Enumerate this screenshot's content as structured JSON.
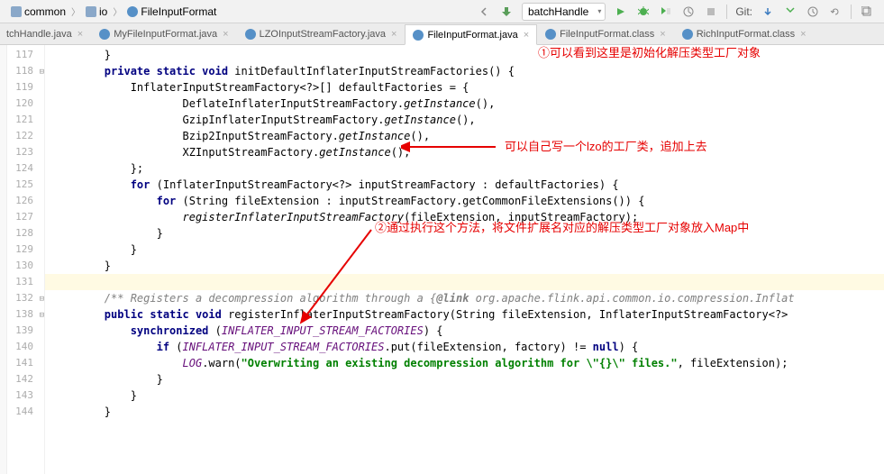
{
  "breadcrumb": {
    "items": [
      {
        "label": "common",
        "icon": "folder"
      },
      {
        "label": "io",
        "icon": "folder"
      },
      {
        "label": "FileInputFormat",
        "icon": "class"
      }
    ]
  },
  "toolbar": {
    "run_config": "batchHandle",
    "git_label": "Git:"
  },
  "tabs": [
    {
      "label": "tchHandle.java",
      "icon": "j",
      "partial": true
    },
    {
      "label": "MyFileInputFormat.java",
      "icon": "c"
    },
    {
      "label": "LZOInputStreamFactory.java",
      "icon": "c"
    },
    {
      "label": "FileInputFormat.java",
      "icon": "c",
      "active": true
    },
    {
      "label": "FileInputFormat.class",
      "icon": "c"
    },
    {
      "label": "RichInputFormat.class",
      "icon": "c"
    }
  ],
  "annotations": {
    "note1": "①可以看到这里是初始化解压类型工厂对象",
    "note2": "可以自己写一个lzo的工厂类，追加上去",
    "note3": "②通过执行这个方法，将文件扩展名对应的解压类型工厂对象放入Map中"
  },
  "line_numbers": [
    "117",
    "118",
    "119",
    "120",
    "121",
    "122",
    "123",
    "124",
    "125",
    "126",
    "127",
    "128",
    "129",
    "130",
    "131",
    "132",
    "138",
    "139",
    "140",
    "141",
    "142",
    "143",
    "144"
  ],
  "code": {
    "l117": "        }",
    "l118_private": "private static void",
    "l118_name": " initDefaultInflaterInputStreamFactories",
    "l118_rest": "() {",
    "l119": "            InflaterInputStreamFactory<?>[] defaultFactories = {",
    "l120a": "                    DeflateInflaterInputStreamFactory.",
    "l120b": "getInstance",
    "l120c": "(),",
    "l121a": "                    GzipInflaterInputStreamFactory.",
    "l121b": "getInstance",
    "l121c": "(),",
    "l122a": "                    Bzip2InputStreamFactory.",
    "l122b": "getInstance",
    "l122c": "(),",
    "l123a": "                    XZInputStreamFactory.",
    "l123b": "getInstance",
    "l123c": "(),",
    "l124": "            };",
    "l125_for": "for",
    "l125_rest": " (InflaterInputStreamFactory<?> inputStreamFactory : defaultFactories) {",
    "l126_for": "for",
    "l126_rest": " (String fileExtension : inputStreamFactory.getCommonFileExtensions()) {",
    "l127a": "                    ",
    "l127b": "registerInflaterInputStreamFactory",
    "l127c": "(fileExtension, inputStreamFactory);",
    "l128": "                }",
    "l129": "            }",
    "l130": "        }",
    "l131": "",
    "l132a": "        ",
    "l132b": "/** Registers a decompression algorithm through a {",
    "l132c": "@link",
    "l132d": " org.apache.flink.api.common.io.compression.Inflat",
    "l138_pub": "public static void",
    "l138_name": " registerInflaterInputStreamFactory",
    "l138_rest": "(String fileExtension, InflaterInputStreamFactory<?>",
    "l139_sync": "synchronized",
    "l139_rest": " (",
    "l139_field": "INFLATER_INPUT_STREAM_FACTORIES",
    "l139_end": ") {",
    "l140_if": "if",
    "l140_a": " (",
    "l140_field": "INFLATER_INPUT_STREAM_FACTORIES",
    "l140_b": ".put(fileExtension, factory) != ",
    "l140_null": "null",
    "l140_c": ") {",
    "l141_a": "                    ",
    "l141_log": "LOG",
    "l141_b": ".warn(",
    "l141_str": "\"Overwriting an existing decompression algorithm for \\\"{}\\\" files.\"",
    "l141_c": ", fileExtension);",
    "l142": "                }",
    "l143": "            }",
    "l144": "        }"
  }
}
